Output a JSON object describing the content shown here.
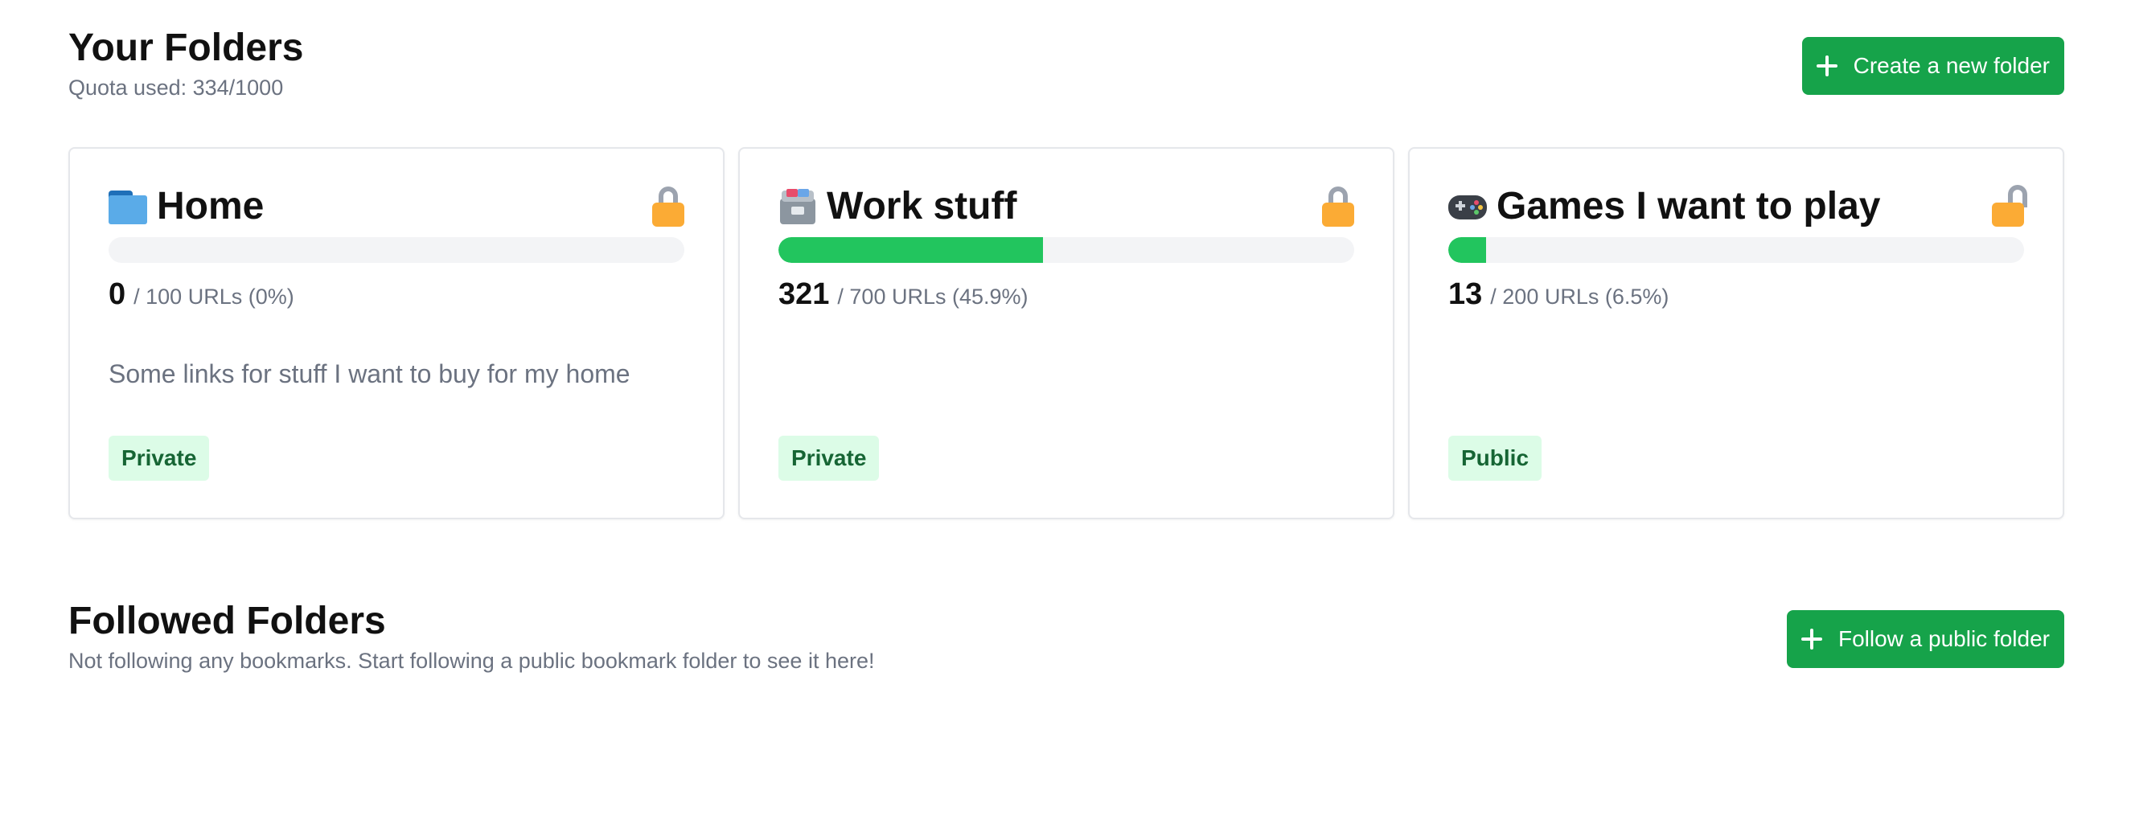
{
  "your_folders": {
    "title": "Your Folders",
    "quota_text": "Quota used: 334/1000",
    "create_button_label": "Create a new folder",
    "folders": [
      {
        "icon": "folder-icon",
        "name": "Home",
        "count": "0",
        "count_suffix": "/ 100 URLs (0%)",
        "progress_fraction": 0.0,
        "description": "Some links for stuff I want to buy for my home",
        "visibility": "Private",
        "lock_icon": "lock-closed-icon"
      },
      {
        "icon": "card-file-box-icon",
        "name": "Work stuff",
        "count": "321",
        "count_suffix": "/ 700 URLs (45.9%)",
        "progress_fraction": 0.459,
        "description": "",
        "visibility": "Private",
        "lock_icon": "lock-closed-icon"
      },
      {
        "icon": "gamepad-icon",
        "name": "Games I want to play",
        "count": "13",
        "count_suffix": "/ 200 URLs (6.5%)",
        "progress_fraction": 0.065,
        "description": "",
        "visibility": "Public",
        "lock_icon": "lock-open-icon"
      }
    ]
  },
  "followed_folders": {
    "title": "Followed Folders",
    "empty_text": "Not following any bookmarks. Start following a public bookmark folder to see it here!",
    "follow_button_label": "Follow a public folder"
  },
  "colors": {
    "primary_button": "#16a34a",
    "progress_fill": "#22c55e",
    "progress_track": "#f3f4f6",
    "badge_bg": "#dcfce7",
    "badge_text": "#166534",
    "lock_body": "#fbab35"
  }
}
